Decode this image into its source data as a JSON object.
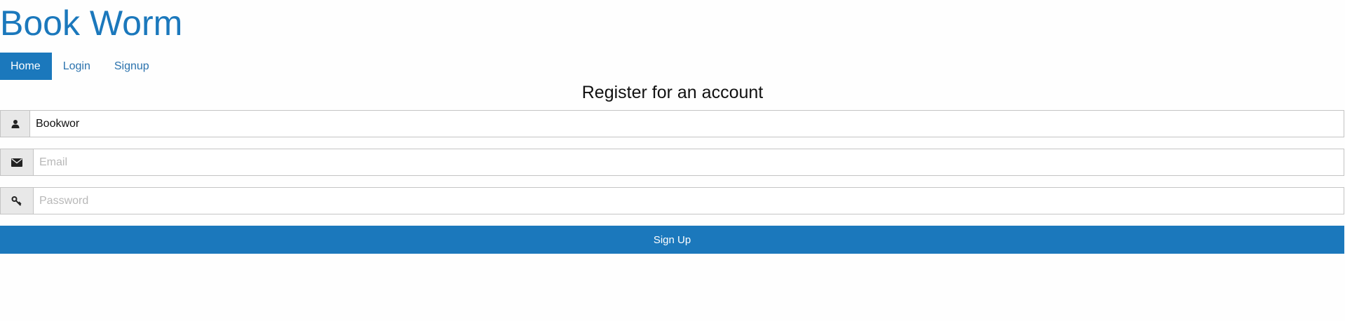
{
  "app": {
    "title": "Book Worm"
  },
  "nav": {
    "items": [
      {
        "label": "Home"
      },
      {
        "label": "Login"
      },
      {
        "label": "Signup"
      }
    ],
    "active": "Home"
  },
  "form": {
    "title": "Register for an account",
    "username": {
      "value": "Bookwor",
      "icon": "user-icon"
    },
    "email": {
      "value": "",
      "placeholder": "Email",
      "icon": "envelope-icon"
    },
    "password": {
      "value": "",
      "placeholder": "Password",
      "icon": "key-icon"
    },
    "submit_label": "Sign Up"
  },
  "colors": {
    "accent": "#1b78bc",
    "addon_bg": "#e8e8e8",
    "border": "#c4c4c4"
  }
}
